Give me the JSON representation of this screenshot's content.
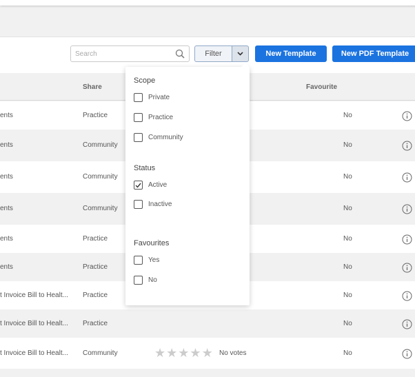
{
  "toolbar": {
    "search_placeholder": "Search",
    "filter_label": "Filter",
    "new_template_label": "New Template",
    "new_pdf_template_label": "New PDF Template"
  },
  "table": {
    "columns": {
      "share": "Share",
      "favourite": "Favourite"
    },
    "rows": [
      {
        "name": "ents",
        "share": "Practice",
        "favourite": "No"
      },
      {
        "name": "ents",
        "share": "Community",
        "favourite": "No"
      },
      {
        "name": "ents",
        "share": "Community",
        "favourite": "No"
      },
      {
        "name": "ents",
        "share": "Community",
        "favourite": "No"
      },
      {
        "name": "ents",
        "share": "Practice",
        "favourite": "No"
      },
      {
        "name": "ents",
        "share": "Practice",
        "favourite": "No"
      },
      {
        "name": "t Invoice Bill to Healt...",
        "share": "Practice",
        "favourite": "No"
      },
      {
        "name": "t Invoice Bill to Healt...",
        "share": "Practice",
        "favourite": "No"
      },
      {
        "name": "t Invoice Bill to Healt...",
        "share": "Community",
        "favourite": "No",
        "votes": "No votes"
      }
    ]
  },
  "filter_menu": {
    "scope": {
      "title": "Scope",
      "options": [
        {
          "label": "Private",
          "checked": false
        },
        {
          "label": "Practice",
          "checked": false
        },
        {
          "label": "Community",
          "checked": false
        }
      ]
    },
    "status": {
      "title": "Status",
      "options": [
        {
          "label": "Active",
          "checked": true
        },
        {
          "label": "Inactive",
          "checked": false
        }
      ]
    },
    "favourites": {
      "title": "Favourites",
      "options": [
        {
          "label": "Yes",
          "checked": false
        },
        {
          "label": "No",
          "checked": false
        }
      ]
    }
  },
  "colors": {
    "primary": "#1b73e0",
    "row_alt": "#f1f1f1"
  },
  "icons": {
    "search": "search-icon",
    "info": "info-icon",
    "caret": "chevron-down-icon",
    "check": "check-icon",
    "star": "star-icon"
  }
}
